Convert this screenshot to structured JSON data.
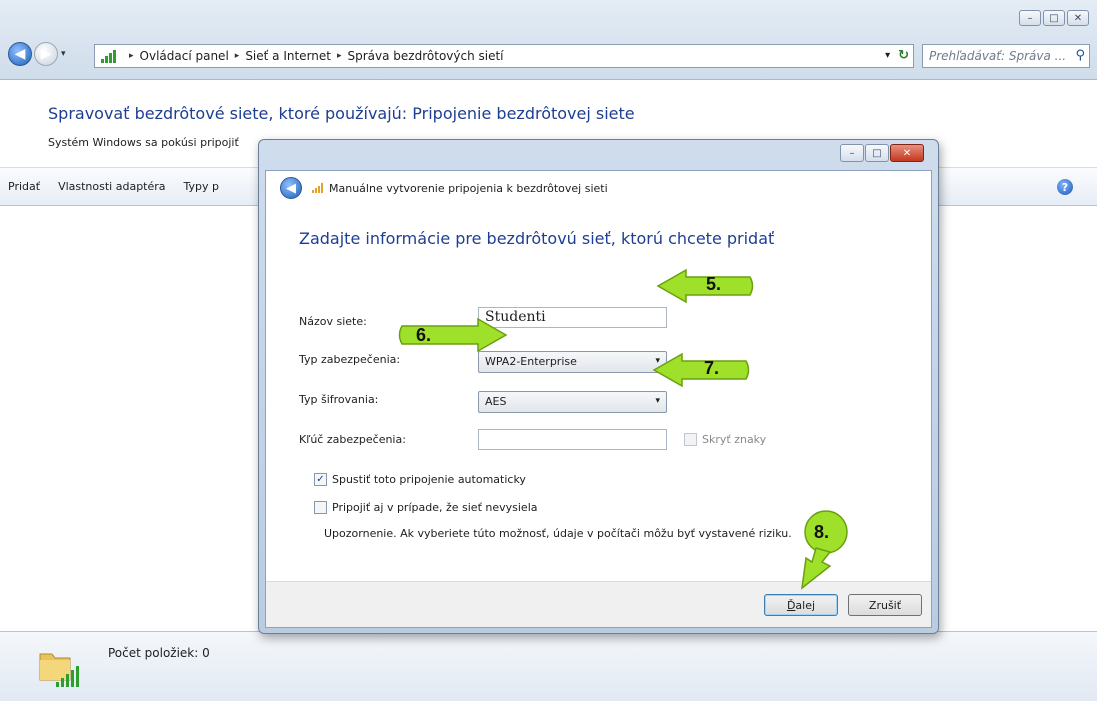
{
  "window": {
    "controls": {
      "minimize": "–",
      "maximize": "□",
      "close": "✕"
    }
  },
  "nav": {
    "back_glyph": "◀",
    "forward_glyph": "▶",
    "history_glyph": "▾",
    "breadcrumb": [
      "Ovládací panel",
      "Sieť a Internet",
      "Správa bezdrôtových sietí"
    ],
    "crumb_sep": "▸",
    "address_drop": "▾",
    "refresh_glyph": "↻",
    "search_placeholder": "Prehľadávať: Správa ..."
  },
  "header": {
    "title": "Spravovať bezdrôtové siete, ktoré používajú: Pripojenie bezdrôtovej siete",
    "description": "Systém Windows sa pokúsi pripojiť"
  },
  "toolbar": {
    "items": [
      "Pridať",
      "Vlastnosti adaptéra",
      "Typy p"
    ],
    "help_glyph": "?"
  },
  "details": {
    "count_text": "Počet položiek: 0"
  },
  "dialog": {
    "title": "Manuálne vytvorenie pripojenia k bezdrôtovej sieti",
    "back_glyph": "◀",
    "heading": "Zadajte informácie pre bezdrôtovú sieť, ktorú chcete pridať",
    "fields": {
      "network_name_label": "Názov siete:",
      "network_name_value": "Studenti",
      "security_type_label": "Typ zabezpečenia:",
      "security_type_value": "WPA2-Enterprise",
      "encryption_type_label": "Typ šifrovania:",
      "encryption_type_value": "AES",
      "security_key_label": "Kľúč zabezpečenia:",
      "security_key_value": "",
      "hide_chars_label": "Skryť znaky",
      "select_caret": "▾"
    },
    "options": {
      "auto_connect_label": "Spustiť toto pripojenie automaticky",
      "auto_connect_checked": true,
      "connect_hidden_label": "Pripojiť aj v prípade, že sieť nevysiela",
      "connect_hidden_checked": false,
      "check_glyph": "✓",
      "warning": "Upozornenie. Ak vyberiete túto možnosť, údaje v počítači môžu byť vystavené riziku."
    },
    "buttons": {
      "next_underline": "Ď",
      "next_rest": "alej",
      "cancel": "Zrušiť"
    }
  },
  "callouts": [
    "5.",
    "6.",
    "7.",
    "8."
  ],
  "colors": {
    "accent_blue": "#1e3e93",
    "callout_green": "#9ee02a"
  }
}
